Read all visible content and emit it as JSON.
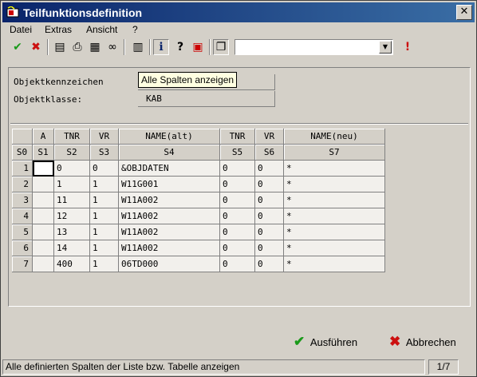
{
  "window": {
    "title": "Teilfunktionsdefinition",
    "close_label": "✕"
  },
  "menu": [
    "Datei",
    "Extras",
    "Ansicht",
    "?"
  ],
  "toolbar": {
    "icons": [
      "check-icon",
      "cancel-x-icon",
      "properties-icon",
      "print-icon",
      "print-setup-icon",
      "binoculars-icon",
      "columns-icon",
      "info-icon",
      "help-icon",
      "picture-icon",
      "window-icon",
      "exclamation-icon"
    ],
    "combo_value": ""
  },
  "form": {
    "objektkennzeichen_label": "Objektkennzeichen",
    "objektkennzeichen_value": "",
    "objektklasse_label": "Objektklasse:",
    "objektklasse_value": "KAB"
  },
  "tooltip": "Alle Spalten anzeigen",
  "table": {
    "headers_row1": [
      "",
      "A",
      "TNR",
      "VR",
      "NAME(alt)",
      "TNR",
      "VR",
      "NAME(neu)"
    ],
    "headers_row2": [
      "S0",
      "S1",
      "S2",
      "S3",
      "S4",
      "S5",
      "S6",
      "S7"
    ],
    "rows": [
      [
        "1",
        "",
        "0",
        "0",
        "&OBJDATEN",
        "0",
        "0",
        "*"
      ],
      [
        "2",
        "",
        "1",
        "1",
        "W11G001",
        "0",
        "0",
        "*"
      ],
      [
        "3",
        "",
        "11",
        "1",
        "W11A002",
        "0",
        "0",
        "*"
      ],
      [
        "4",
        "",
        "12",
        "1",
        "W11A002",
        "0",
        "0",
        "*"
      ],
      [
        "5",
        "",
        "13",
        "1",
        "W11A002",
        "0",
        "0",
        "*"
      ],
      [
        "6",
        "",
        "14",
        "1",
        "W11A002",
        "0",
        "0",
        "*"
      ],
      [
        "7",
        "",
        "400",
        "1",
        "06TD000",
        "0",
        "0",
        "*"
      ]
    ]
  },
  "buttons": {
    "execute": "Ausführen",
    "cancel": "Abbrechen"
  },
  "status": {
    "text": "Alle definierten Spalten der Liste bzw. Tabelle anzeigen",
    "page": "1/7"
  },
  "colors": {
    "title_start": "#0a246a",
    "title_end": "#3a6ea5",
    "ok_green": "#1a9a1a",
    "cancel_red": "#cc1010"
  }
}
